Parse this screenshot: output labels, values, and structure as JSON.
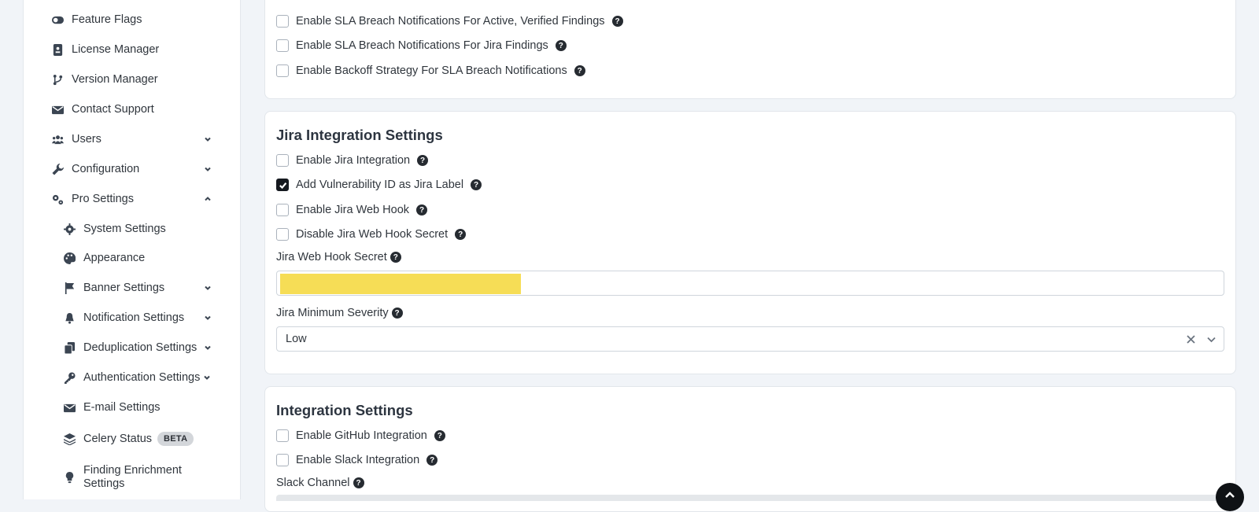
{
  "sidebar": {
    "items": [
      {
        "label": "Feature Flags",
        "icon": "toggle-icon"
      },
      {
        "label": "License Manager",
        "icon": "license-icon"
      },
      {
        "label": "Version Manager",
        "icon": "branch-icon"
      },
      {
        "label": "Contact Support",
        "icon": "envelope-icon"
      },
      {
        "label": "Users",
        "icon": "users-icon"
      },
      {
        "label": "Configuration",
        "icon": "wrench-icon"
      },
      {
        "label": "Pro Settings",
        "icon": "gears-icon"
      }
    ],
    "sub_items": [
      {
        "label": "System Settings",
        "icon": "gear-icon"
      },
      {
        "label": "Appearance",
        "icon": "palette-icon"
      },
      {
        "label": "Banner Settings",
        "icon": "flag-icon"
      },
      {
        "label": "Notification Settings",
        "icon": "bell-icon"
      },
      {
        "label": "Deduplication Settings",
        "icon": "copy-icon"
      },
      {
        "label": "Authentication Settings",
        "icon": "key-icon"
      },
      {
        "label": "E-mail Settings",
        "icon": "envelope-icon"
      },
      {
        "label": "Celery Status",
        "icon": "layers-icon",
        "badge": "BETA"
      },
      {
        "label": "Finding Enrichment Settings",
        "icon": "lightbulb-icon"
      }
    ]
  },
  "sla_card": {
    "checkboxes": [
      {
        "label": "Enable SLA Breach Notifications For Active, Verified Findings",
        "checked": false
      },
      {
        "label": "Enable SLA Breach Notifications For Jira Findings",
        "checked": false
      },
      {
        "label": "Enable Backoff Strategy For SLA Breach Notifications",
        "checked": false
      }
    ]
  },
  "jira_card": {
    "title": "Jira Integration Settings",
    "checkboxes": [
      {
        "label": "Enable Jira Integration",
        "checked": false
      },
      {
        "label": "Add Vulnerability ID as Jira Label",
        "checked": true
      },
      {
        "label": "Enable Jira Web Hook",
        "checked": false
      },
      {
        "label": "Disable Jira Web Hook Secret",
        "checked": false
      }
    ],
    "secret_label": "Jira Web Hook Secret",
    "min_severity_label": "Jira Minimum Severity",
    "min_severity_value": "Low"
  },
  "integration_card": {
    "title": "Integration Settings",
    "checkboxes": [
      {
        "label": "Enable GitHub Integration",
        "checked": false
      },
      {
        "label": "Enable Slack Integration",
        "checked": false
      }
    ],
    "slack_channel_label": "Slack Channel"
  },
  "help_glyph": "?",
  "colors": {
    "redaction": "#f6dd56",
    "checked": "#15191f"
  }
}
